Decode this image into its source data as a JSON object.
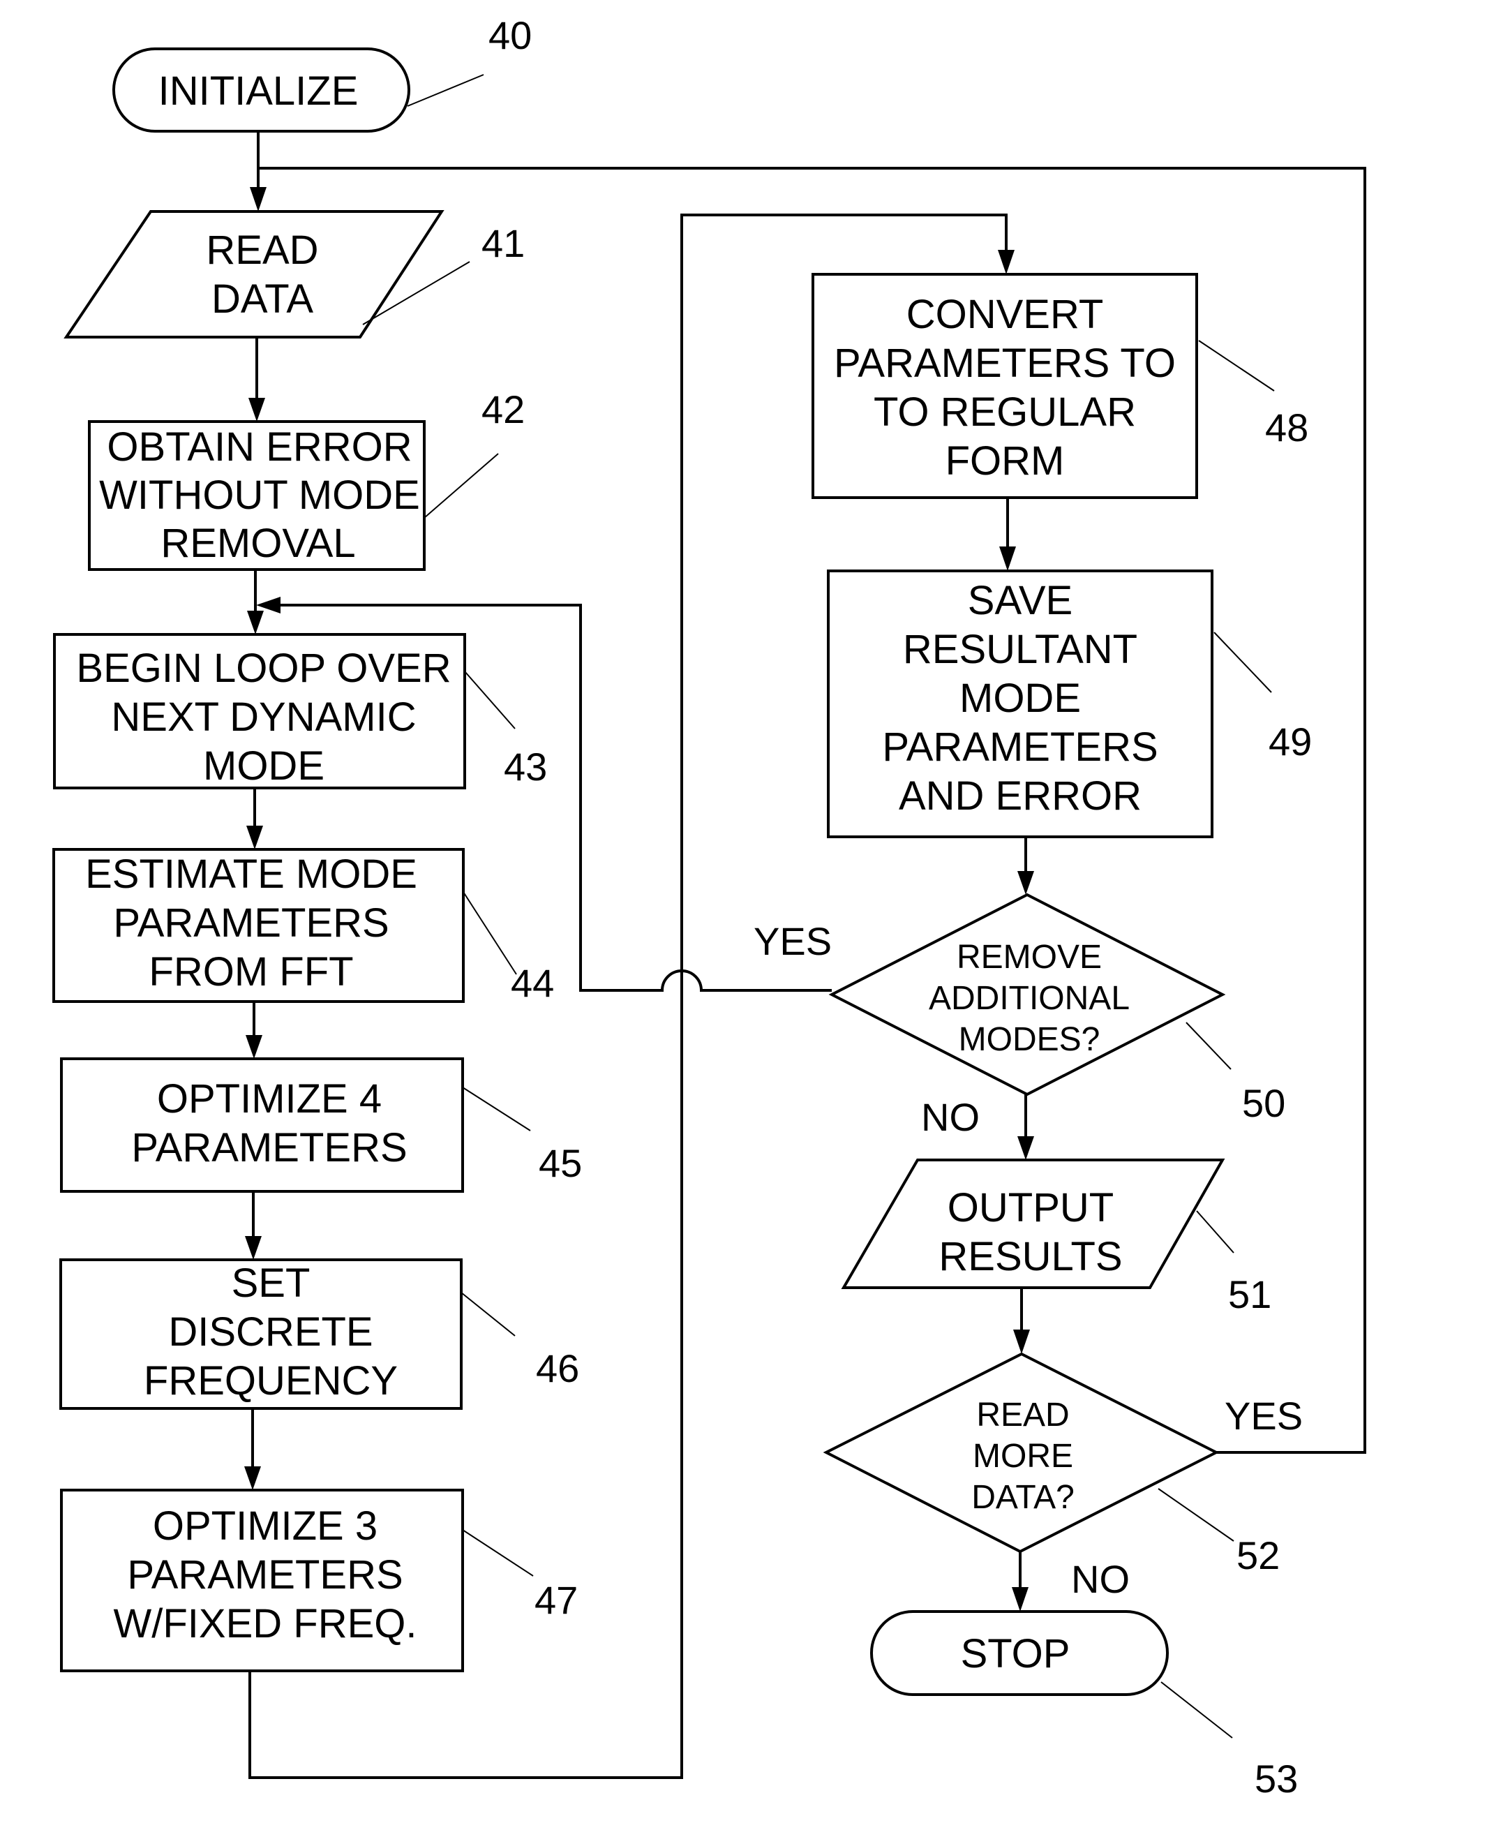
{
  "figure": {
    "type": "flowchart",
    "nodes": [
      {
        "id": "40",
        "shape": "terminator",
        "lines": [
          "INITIALIZE"
        ]
      },
      {
        "id": "41",
        "shape": "data",
        "lines": [
          "READ",
          "DATA"
        ]
      },
      {
        "id": "42",
        "shape": "process",
        "lines": [
          "OBTAIN ERROR",
          "WITHOUT MODE",
          "REMOVAL"
        ]
      },
      {
        "id": "43",
        "shape": "process",
        "lines": [
          "BEGIN LOOP OVER",
          "NEXT DYNAMIC",
          "MODE"
        ]
      },
      {
        "id": "44",
        "shape": "process",
        "lines": [
          "ESTIMATE MODE",
          "PARAMETERS",
          "FROM FFT"
        ]
      },
      {
        "id": "45",
        "shape": "process",
        "lines": [
          "OPTIMIZE 4",
          "PARAMETERS"
        ]
      },
      {
        "id": "46",
        "shape": "process",
        "lines": [
          "SET",
          "DISCRETE",
          "FREQUENCY"
        ]
      },
      {
        "id": "47",
        "shape": "process",
        "lines": [
          "OPTIMIZE 3",
          "PARAMETERS",
          "W/FIXED FREQ."
        ]
      },
      {
        "id": "48",
        "shape": "process",
        "lines": [
          "CONVERT",
          "PARAMETERS TO",
          "TO REGULAR",
          "FORM"
        ]
      },
      {
        "id": "49",
        "shape": "process",
        "lines": [
          "SAVE",
          "RESULTANT",
          "MODE",
          "PARAMETERS",
          "AND ERROR"
        ]
      },
      {
        "id": "50",
        "shape": "decision",
        "lines": [
          "REMOVE",
          "ADDITIONAL",
          "MODES?"
        ]
      },
      {
        "id": "51",
        "shape": "data",
        "lines": [
          "OUTPUT",
          "RESULTS"
        ]
      },
      {
        "id": "52",
        "shape": "decision",
        "lines": [
          "READ",
          "MORE",
          "DATA?"
        ]
      },
      {
        "id": "53",
        "shape": "terminator",
        "lines": [
          "STOP"
        ]
      }
    ],
    "edges": [
      {
        "from": "40",
        "to": "41",
        "label": ""
      },
      {
        "from": "41",
        "to": "42",
        "label": ""
      },
      {
        "from": "42",
        "to": "43",
        "label": ""
      },
      {
        "from": "43",
        "to": "44",
        "label": ""
      },
      {
        "from": "44",
        "to": "45",
        "label": ""
      },
      {
        "from": "45",
        "to": "46",
        "label": ""
      },
      {
        "from": "46",
        "to": "47",
        "label": ""
      },
      {
        "from": "47",
        "to": "48",
        "label": ""
      },
      {
        "from": "48",
        "to": "49",
        "label": ""
      },
      {
        "from": "49",
        "to": "50",
        "label": ""
      },
      {
        "from": "50",
        "to": "43",
        "label": "YES"
      },
      {
        "from": "50",
        "to": "51",
        "label": "NO"
      },
      {
        "from": "51",
        "to": "52",
        "label": ""
      },
      {
        "from": "52",
        "to": "41",
        "label": "YES"
      },
      {
        "from": "52",
        "to": "53",
        "label": "NO"
      }
    ],
    "branch_labels": {
      "d50_yes": "YES",
      "d50_no": "NO",
      "d52_yes": "YES",
      "d52_no": "NO"
    }
  }
}
